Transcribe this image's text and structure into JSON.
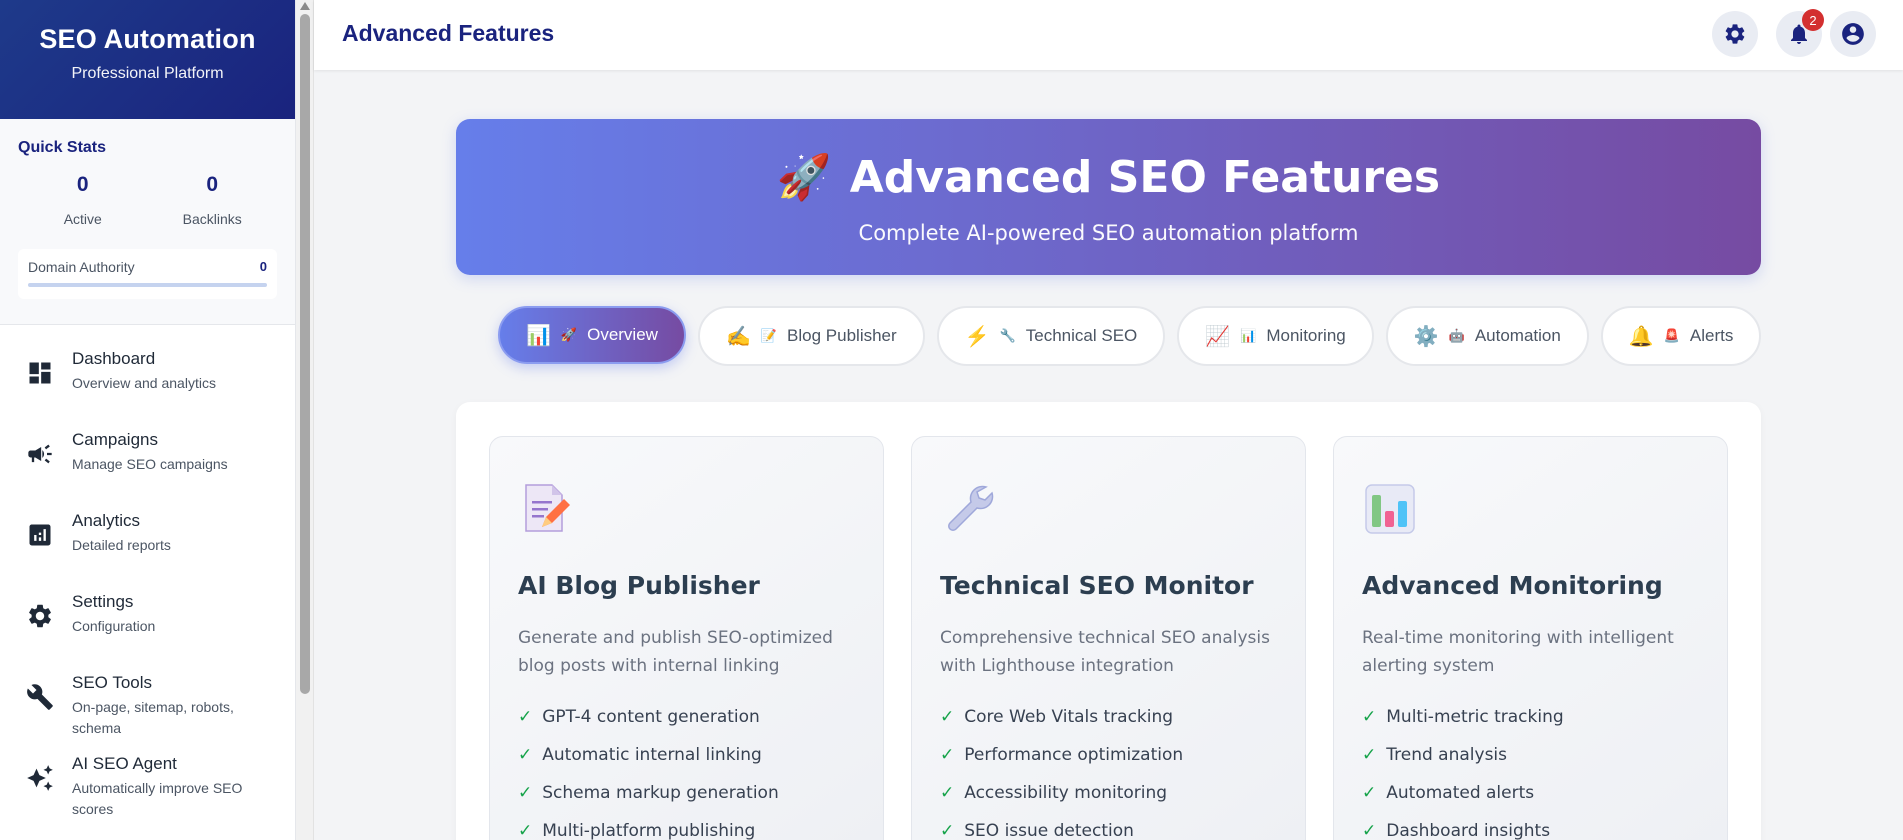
{
  "brand": {
    "title": "SEO Automation",
    "subtitle": "Professional Platform"
  },
  "quick_stats": {
    "title": "Quick Stats",
    "items": [
      {
        "value": "0",
        "label": "Active"
      },
      {
        "value": "0",
        "label": "Backlinks"
      }
    ],
    "domain_authority": {
      "label": "Domain Authority",
      "value": "0"
    }
  },
  "sidebar": {
    "items": [
      {
        "label": "Dashboard",
        "desc": "Overview and analytics",
        "icon": "dashboard-icon"
      },
      {
        "label": "Campaigns",
        "desc": "Manage SEO campaigns",
        "icon": "megaphone-icon"
      },
      {
        "label": "Analytics",
        "desc": "Detailed reports",
        "icon": "analytics-icon"
      },
      {
        "label": "Settings",
        "desc": "Configuration",
        "icon": "gear-icon"
      },
      {
        "label": "SEO Tools",
        "desc": "On-page, sitemap, robots, schema",
        "icon": "wrench-icon"
      },
      {
        "label": "AI SEO Agent",
        "desc": "Automatically improve SEO scores",
        "icon": "sparkles-icon"
      }
    ]
  },
  "header": {
    "title": "Advanced Features",
    "notification_count": "2"
  },
  "hero": {
    "icon": "🚀",
    "title": "Advanced SEO Features",
    "subtitle": "Complete AI-powered SEO automation platform"
  },
  "tabs": [
    {
      "emoji": "📊",
      "emoji2": "🚀",
      "label": "Overview",
      "active": true
    },
    {
      "emoji": "✍️",
      "emoji2": "📝",
      "label": "Blog Publisher",
      "active": false
    },
    {
      "emoji": "⚡",
      "emoji2": "🔧",
      "label": "Technical SEO",
      "active": false
    },
    {
      "emoji": "📈",
      "emoji2": "📊",
      "label": "Monitoring",
      "active": false
    },
    {
      "emoji": "⚙️",
      "emoji2": "🤖",
      "label": "Automation",
      "active": false
    },
    {
      "emoji": "🔔",
      "emoji2": "🚨",
      "label": "Alerts",
      "active": false
    }
  ],
  "cards": [
    {
      "icon": "memo-pencil-icon",
      "title": "AI Blog Publisher",
      "desc": "Generate and publish SEO-optimized blog posts with internal linking",
      "features": [
        "GPT-4 content generation",
        "Automatic internal linking",
        "Schema markup generation",
        "Multi-platform publishing"
      ]
    },
    {
      "icon": "wrench-icon",
      "title": "Technical SEO Monitor",
      "desc": "Comprehensive technical SEO analysis with Lighthouse integration",
      "features": [
        "Core Web Vitals tracking",
        "Performance optimization",
        "Accessibility monitoring",
        "SEO issue detection"
      ]
    },
    {
      "icon": "bar-chart-icon",
      "title": "Advanced Monitoring",
      "desc": "Real-time monitoring with intelligent alerting system",
      "features": [
        "Multi-metric tracking",
        "Trend analysis",
        "Automated alerts",
        "Dashboard insights"
      ]
    }
  ],
  "check_mark": "✓",
  "colors": {
    "primary": "#1a237e",
    "accent_start": "#667eea",
    "accent_end": "#764ba2",
    "check": "#16a34a",
    "badge": "#d32f2f"
  }
}
